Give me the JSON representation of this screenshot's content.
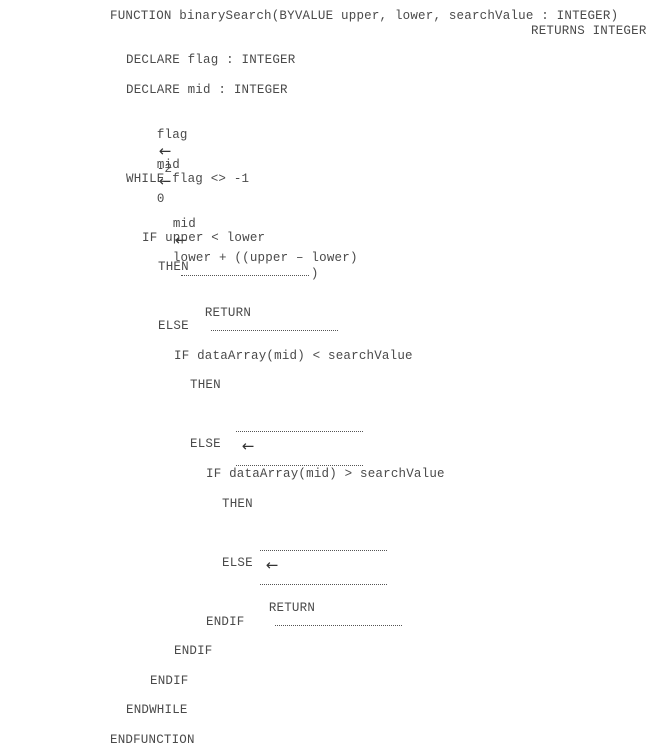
{
  "lines": {
    "function_header": "FUNCTION binarySearch(BYVALUE upper, lower, searchValue : INTEGER)",
    "returns_integer": "RETURNS INTEGER",
    "declare_flag": "DECLARE flag : INTEGER",
    "declare_mid": "DECLARE mid : INTEGER",
    "flag_label": "flag",
    "flag_value": "-2",
    "mid_label": "mid",
    "mid_value": "0",
    "while_line": "WHILE flag <> -1",
    "mid_assign_label": "mid",
    "mid_assign_expr": "lower + ((upper – lower)",
    "mid_assign_close": ")",
    "if_upper_lower": "IF upper < lower",
    "then_1": "THEN",
    "return_1": "RETURN",
    "else_1": "ELSE",
    "if_less": "IF dataArray(mid) < searchValue",
    "then_2": "THEN",
    "else_2": "ELSE",
    "if_greater": "IF dataArray(mid) > searchValue",
    "then_3": "THEN",
    "else_3": "ELSE",
    "return_3": "RETURN",
    "endif_1": "ENDIF",
    "endif_2": "ENDIF",
    "endif_3": "ENDIF",
    "endwhile": "ENDWHILE",
    "endfunction": "ENDFUNCTION"
  },
  "arrow_symbol": "←",
  "colors": {
    "text": "#4a4a4a",
    "dotted_line": "#555555"
  }
}
